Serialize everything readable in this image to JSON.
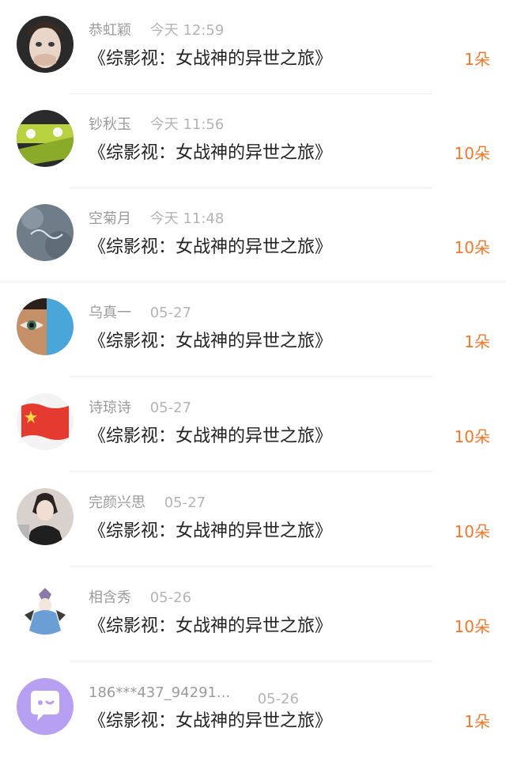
{
  "book_title": "《综影视：女战神的异世之旅》",
  "colors": {
    "gift": "#f0782d",
    "meta": "#9b9b9b",
    "title": "#222222"
  },
  "items": [
    {
      "name": "恭虹颖",
      "time": "今天 12:59",
      "title": "《综影视：女战神的异世之旅》",
      "gift": "1朵",
      "avatar": "avatar-child-covering-mouth"
    },
    {
      "name": "钞秋玉",
      "time": "今天 11:56",
      "title": "《综影视：女战神的异世之旅》",
      "gift": "10朵",
      "avatar": "avatar-sneakers"
    },
    {
      "name": "空菊月",
      "time": "今天 11:48",
      "title": "《综影视：女战神的异世之旅》",
      "gift": "10朵",
      "avatar": "avatar-hello-august"
    },
    {
      "name": "乌真一",
      "time": "05-27",
      "title": "《综影视：女战神的异世之旅》",
      "gift": "1朵",
      "avatar": "avatar-eye-closeup"
    },
    {
      "name": "诗琼诗",
      "time": "05-27",
      "title": "《综影视：女战神的异世之旅》",
      "gift": "10朵",
      "avatar": "avatar-flag"
    },
    {
      "name": "完颜兴思",
      "time": "05-27",
      "title": "《综影视：女战神的异世之旅》",
      "gift": "10朵",
      "avatar": "avatar-girl-portrait"
    },
    {
      "name": "相含秀",
      "time": "05-26",
      "title": "《综影视：女战神的异世之旅》",
      "gift": "10朵",
      "avatar": "avatar-anime-character"
    },
    {
      "name": "186***437_94291...",
      "time": "05-26",
      "title": "《综影视：女战神的异世之旅》",
      "gift": "1朵",
      "avatar": "avatar-default-chat-bubble"
    }
  ]
}
